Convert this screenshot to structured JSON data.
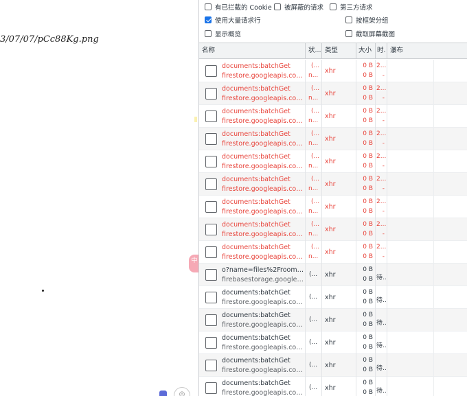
{
  "page": {
    "url_fragment": "3/07/07/pCc88Kg.png",
    "float_badge": "中",
    "bottom_btn": "◎"
  },
  "devtools": {
    "options": {
      "blocked_cookies": {
        "label": "有已拦截的 Cookie",
        "checked": false
      },
      "blocked_requests": {
        "label": "被屏蔽的请求",
        "checked": false
      },
      "third_party": {
        "label": "第三方请求",
        "checked": false
      },
      "big_rows": {
        "label": "使用大量请求行",
        "checked": true
      },
      "group_by_frame": {
        "label": "按框架分组",
        "checked": false
      },
      "overview": {
        "label": "显示概览",
        "checked": false
      },
      "screenshots": {
        "label": "截取屏幕截图",
        "checked": false
      }
    },
    "columns": {
      "name": "名称",
      "status": "状...",
      "type": "类型",
      "size": "大小",
      "time": "时.",
      "waterfall": "瀑布"
    },
    "rows": [
      {
        "name": "documents:batchGet",
        "host": "firestore.googleapis.com/...",
        "status1": "(...",
        "status2": "n...",
        "type": "xhr",
        "size1": "0 B",
        "size2": "0 B",
        "time1": "2...",
        "time2": "-",
        "error": true
      },
      {
        "name": "documents:batchGet",
        "host": "firestore.googleapis.com/...",
        "status1": "(...",
        "status2": "n...",
        "type": "xhr",
        "size1": "0 B",
        "size2": "0 B",
        "time1": "2...",
        "time2": "-",
        "error": true
      },
      {
        "name": "documents:batchGet",
        "host": "firestore.googleapis.com/...",
        "status1": "(...",
        "status2": "n...",
        "type": "xhr",
        "size1": "0 B",
        "size2": "0 B",
        "time1": "2...",
        "time2": "-",
        "error": true
      },
      {
        "name": "documents:batchGet",
        "host": "firestore.googleapis.com/...",
        "status1": "(...",
        "status2": "n...",
        "type": "xhr",
        "size1": "0 B",
        "size2": "0 B",
        "time1": "2...",
        "time2": "-",
        "error": true
      },
      {
        "name": "documents:batchGet",
        "host": "firestore.googleapis.com/...",
        "status1": "(...",
        "status2": "n...",
        "type": "xhr",
        "size1": "0 B",
        "size2": "0 B",
        "time1": "2...",
        "time2": "-",
        "error": true
      },
      {
        "name": "documents:batchGet",
        "host": "firestore.googleapis.com/...",
        "status1": "(...",
        "status2": "n...",
        "type": "xhr",
        "size1": "0 B",
        "size2": "0 B",
        "time1": "2...",
        "time2": "-",
        "error": true
      },
      {
        "name": "documents:batchGet",
        "host": "firestore.googleapis.com/...",
        "status1": "(...",
        "status2": "n...",
        "type": "xhr",
        "size1": "0 B",
        "size2": "0 B",
        "time1": "2...",
        "time2": "-",
        "error": true
      },
      {
        "name": "documents:batchGet",
        "host": "firestore.googleapis.com/...",
        "status1": "(...",
        "status2": "n...",
        "type": "xhr",
        "size1": "0 B",
        "size2": "0 B",
        "time1": "2...",
        "time2": "-",
        "error": true
      },
      {
        "name": "documents:batchGet",
        "host": "firestore.googleapis.com/...",
        "status1": "(...",
        "status2": "n...",
        "type": "xhr",
        "size1": "0 B",
        "size2": "0 B",
        "time1": "2...",
        "time2": "-",
        "error": true
      },
      {
        "name": "o?name=files%2Frooms%...",
        "host": "firebasestorage.googleapi...",
        "status": "(...",
        "type": "xhr",
        "size1": "0 B",
        "size2": "0 B",
        "time": "待...",
        "error": false
      },
      {
        "name": "documents:batchGet",
        "host": "firestore.googleapis.com/...",
        "status": "(...",
        "type": "xhr",
        "size1": "0 B",
        "size2": "0 B",
        "time": "待...",
        "error": false
      },
      {
        "name": "documents:batchGet",
        "host": "firestore.googleapis.com/...",
        "status": "(...",
        "type": "xhr",
        "size1": "0 B",
        "size2": "0 B",
        "time": "待...",
        "error": false
      },
      {
        "name": "documents:batchGet",
        "host": "firestore.googleapis.com/...",
        "status": "(...",
        "type": "xhr",
        "size1": "0 B",
        "size2": "0 B",
        "time": "待...",
        "error": false
      },
      {
        "name": "documents:batchGet",
        "host": "firestore.googleapis.com/...",
        "status": "(...",
        "type": "xhr",
        "size1": "0 B",
        "size2": "0 B",
        "time": "待...",
        "error": false
      },
      {
        "name": "documents:batchGet",
        "host": "firestore.googleapis.com/...",
        "status": "(...",
        "type": "xhr",
        "size1": "0 B",
        "size2": "0 B",
        "time": "待...",
        "error": false
      }
    ],
    "colors": {
      "error": "#e8453c",
      "accent": "#1a73e8"
    }
  }
}
